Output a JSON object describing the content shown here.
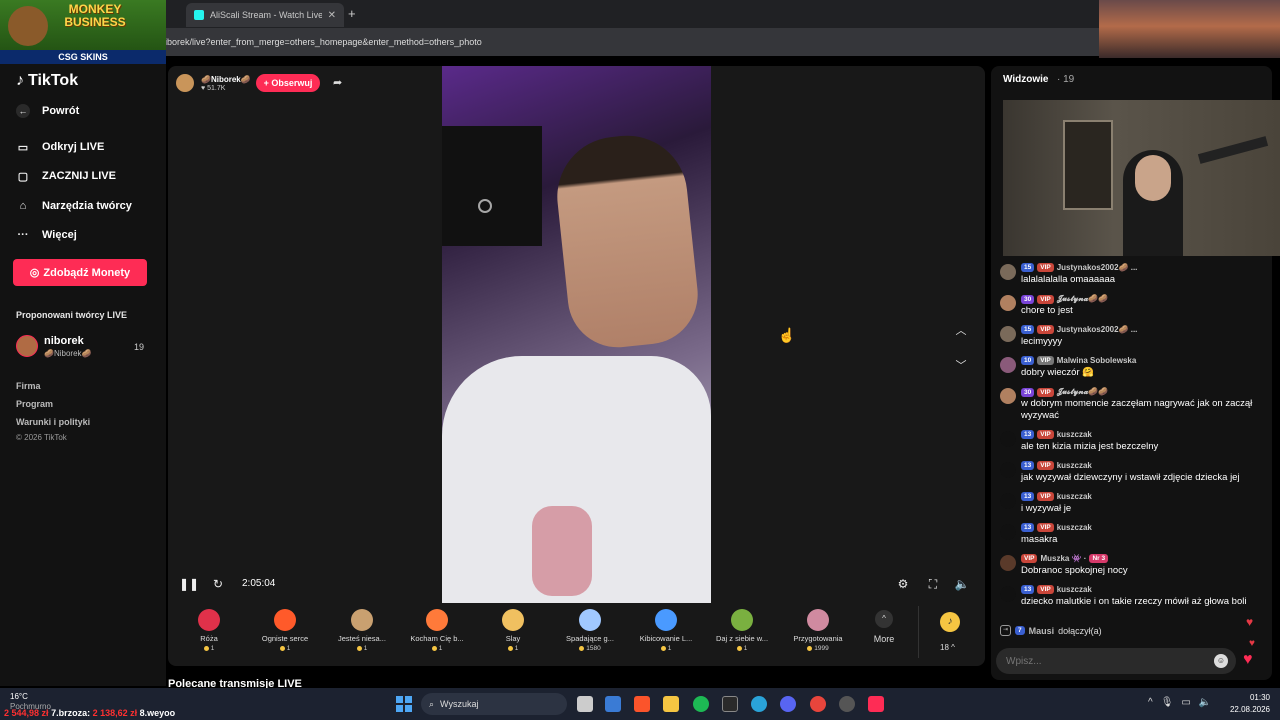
{
  "browser": {
    "tabs": [
      {
        "label": ""
      },
      {
        "label": "AliScali Stream - Watch Live on"
      }
    ],
    "new_tab": "+",
    "close_glyph": "✕",
    "url": "iborek/live?enter_from_merge=others_homepage&enter_method=others_photo"
  },
  "promo": {
    "title_line1": "MONKEY",
    "title_line2": "BUSINESS",
    "strip": "CSG SKINS"
  },
  "sidebar": {
    "brand": "TikTok",
    "items": [
      {
        "label": "Powrót",
        "icon": "back-arrow-icon"
      },
      {
        "label": "Odkryj LIVE",
        "icon": "live-icon"
      },
      {
        "label": "ZACZNIJ LIVE",
        "icon": "camera-icon"
      },
      {
        "label": "Narzędzia twórcy",
        "icon": "home-tools-icon"
      },
      {
        "label": "Więcej",
        "icon": "more-dots-icon"
      }
    ],
    "coins_button": "Zdobądź Monety",
    "suggested_title": "Proponowani twórcy LIVE",
    "suggested": {
      "name": "niborek",
      "sub": "🥔Niborek🥔",
      "count": "19"
    },
    "footer": [
      "Firma",
      "Program",
      "Warunki i polityki"
    ],
    "copyright": "© 2026 TikTok"
  },
  "stream": {
    "streamer_name": "🥔Niborek🥔",
    "likes": "♥ 51.7K",
    "follow": "+ Obserwuj",
    "timer": "2:05:04"
  },
  "gifts": [
    {
      "name": "Róża",
      "price": "1",
      "color": "#e0314a"
    },
    {
      "name": "Ogniste serce",
      "price": "1",
      "color": "#ff5a2a"
    },
    {
      "name": "Jesteś niesa...",
      "price": "1",
      "color": "#c9a070"
    },
    {
      "name": "Kocham Cię b...",
      "price": "1",
      "color": "#ff7a3a"
    },
    {
      "name": "Slay",
      "price": "1",
      "color": "#f0c060"
    },
    {
      "name": "Spadające g...",
      "price": "1580",
      "color": "#a0c8ff"
    },
    {
      "name": "Kibicowanie L...",
      "price": "1",
      "color": "#4a9aff"
    },
    {
      "name": "Daj z siebie w...",
      "price": "1",
      "color": "#7ab040"
    },
    {
      "name": "Przygotowania",
      "price": "1999",
      "color": "#d08aa0"
    }
  ],
  "gift_more": {
    "label": "More",
    "arrow": "^"
  },
  "coins": {
    "count": "18 ^",
    "symbol": "♪"
  },
  "recommended_title": "Polecane transmisje LIVE",
  "chat": {
    "title": "Widzowie",
    "viewer_count": "· 19",
    "messages": [
      {
        "level": "15",
        "lvl_type": "blue",
        "vip": "VIP",
        "vip_type": "red",
        "name": "Justynakos2002🥔 ...",
        "text": "lalalalalalla omaaaaaa",
        "avatar": "#7a6a5a"
      },
      {
        "level": "30",
        "lvl_type": "purple",
        "vip": "VIP",
        "vip_type": "red",
        "name": "𝓙𝓾𝓼𝓽𝔂𝓷𝓪🥔🥔",
        "text": "chore to jest",
        "avatar": "#b08060"
      },
      {
        "level": "15",
        "lvl_type": "blue",
        "vip": "VIP",
        "vip_type": "red",
        "name": "Justynakos2002🥔 ...",
        "text": "lecimyyyy",
        "avatar": "#7a6a5a"
      },
      {
        "level": "10",
        "lvl_type": "blue",
        "vip": "VIP",
        "vip_type": "gray",
        "name": "Malwina Sobolewska",
        "text": "dobry wieczór 🤗",
        "avatar": "#8a5a7a"
      },
      {
        "level": "30",
        "lvl_type": "purple",
        "vip": "VIP",
        "vip_type": "red",
        "name": "𝓙𝓾𝓼𝓽𝔂𝓷𝓪🥔🥔",
        "text": "w dobrym momencie zaczęłam nagrywać jak on zaczął wyzywać",
        "avatar": "#b08060"
      },
      {
        "level": "13",
        "lvl_type": "blue",
        "vip": "VIP",
        "vip_type": "red",
        "name": "kuszczak",
        "text": "ale ten kizia mizia jest bezczelny",
        "avatar": "#111"
      },
      {
        "level": "13",
        "lvl_type": "blue",
        "vip": "VIP",
        "vip_type": "red",
        "name": "kuszczak",
        "text": "jak wyzywał dziewczyny i wstawił zdjęcie dziecka jej",
        "avatar": "#111"
      },
      {
        "level": "13",
        "lvl_type": "blue",
        "vip": "VIP",
        "vip_type": "red",
        "name": "kuszczak",
        "text": "i wyzywał je",
        "avatar": "#111"
      },
      {
        "level": "13",
        "lvl_type": "blue",
        "vip": "VIP",
        "vip_type": "red",
        "name": "kuszczak",
        "text": "masakra",
        "avatar": "#111"
      },
      {
        "level": "",
        "lvl_type": "",
        "vip": "VIP",
        "vip_type": "red",
        "name": "Muszka 👾 ·",
        "nr": "Nr 3",
        "text": "Dobranoc spokojnej nocy",
        "avatar": "#5a3a2a"
      },
      {
        "level": "13",
        "lvl_type": "blue",
        "vip": "VIP",
        "vip_type": "red",
        "name": "kuszczak",
        "text": "dziecko malutkie i on takie rzeczy mówił aż głowa boli",
        "avatar": "#111"
      }
    ],
    "joined": {
      "level": "7",
      "name": "Mausi",
      "action": "dołączył(a)"
    },
    "input_placeholder": "Wpisz..."
  },
  "taskbar": {
    "temp": "16°C",
    "weather": "Pochmurno",
    "ticker_a": "2 544,98 zł",
    "ticker_b": "7.brzoza:",
    "ticker_c": "2 138,62 zł",
    "ticker_d": "8.weyoo",
    "search": "Wyszukaj",
    "time": "01:30",
    "date": "22.08.2026"
  }
}
